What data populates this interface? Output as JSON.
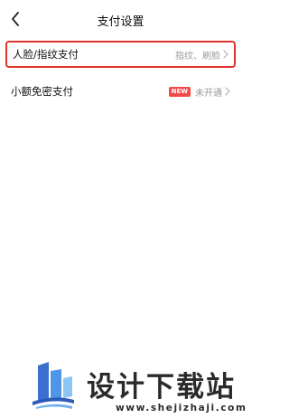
{
  "header": {
    "title": "支付设置"
  },
  "settings": [
    {
      "label": "人脸/指纹支付",
      "value": "指纹、刷脸",
      "badge": ""
    },
    {
      "label": "小额免密支付",
      "value": "未开通",
      "badge": "NEW"
    }
  ],
  "watermark": {
    "brand_name": "设计下载站",
    "url": "www.shejizhaji.com"
  },
  "colors": {
    "highlight": "#e0352f",
    "badge": "#f04b4b",
    "secondary_text": "#9a9a9a"
  },
  "icons": [
    "back-arrow-icon",
    "chevron-right-icon",
    "brand-logo"
  ]
}
